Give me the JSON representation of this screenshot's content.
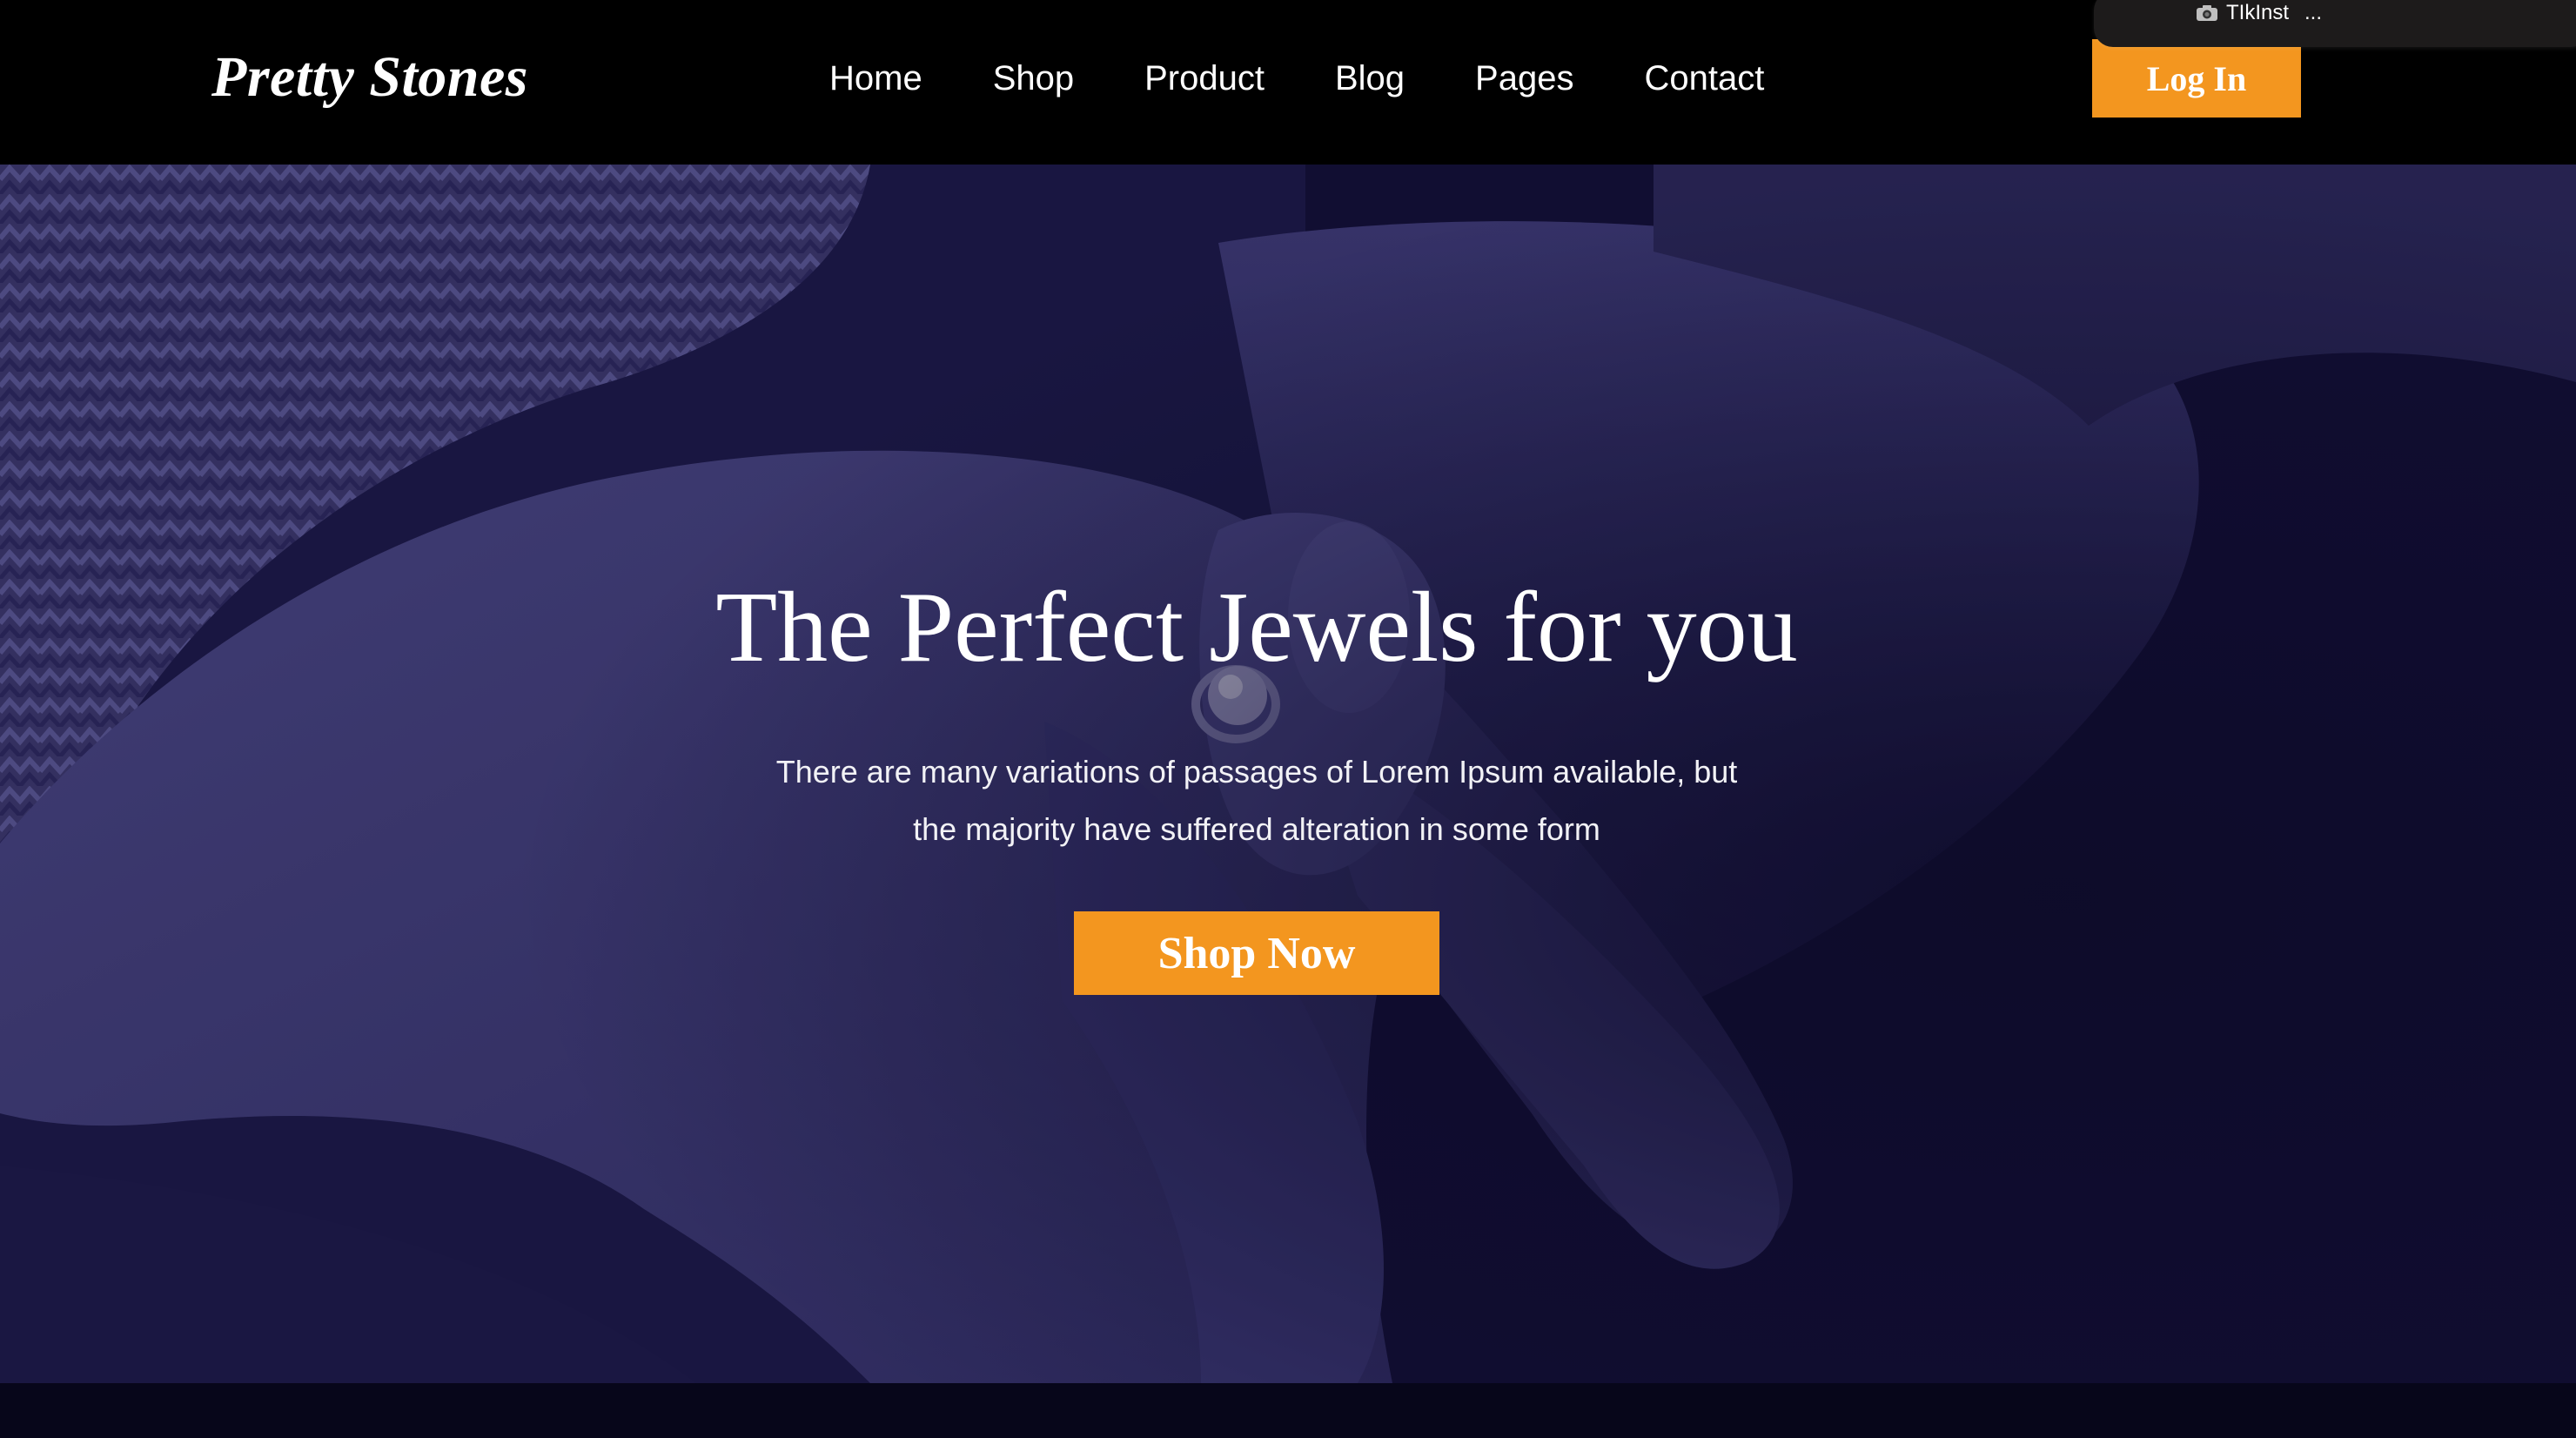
{
  "brand": {
    "name": "Pretty Stones"
  },
  "nav": {
    "items": [
      {
        "label": "Home"
      },
      {
        "label": "Shop"
      },
      {
        "label": "Product"
      },
      {
        "label": "Blog"
      },
      {
        "label": "Pages"
      },
      {
        "label": "Contact"
      }
    ],
    "login_label": "Log In"
  },
  "recorder": {
    "label": "TIkInst",
    "more": "..."
  },
  "hero": {
    "title": "The Perfect Jewels for you",
    "text_line1": "There are many variations of passages of Lorem Ipsum available, but",
    "text_line2": "the majority have suffered alteration in some form",
    "cta_label": "Shop Now",
    "background_icon": "hand-with-ring-image"
  },
  "colors": {
    "header_bg": "#000000",
    "accent": "#f3961f",
    "hero_tint": "#2a2855",
    "page_bg": "#07061a"
  }
}
